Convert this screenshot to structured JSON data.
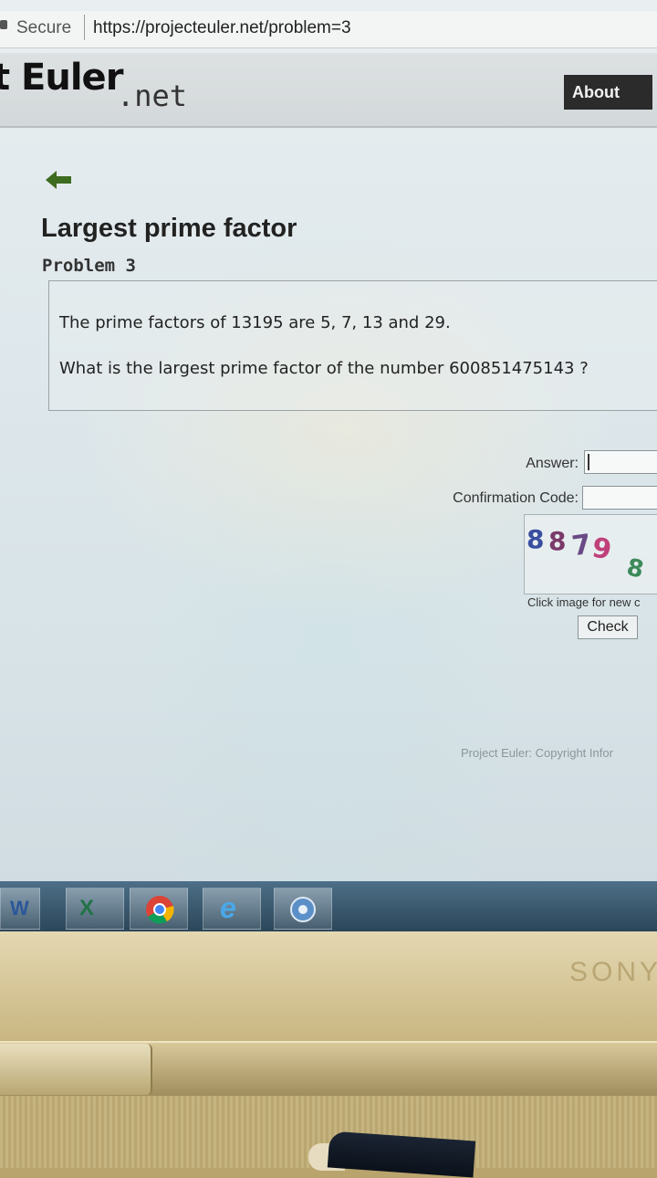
{
  "browser": {
    "secure_label": "Secure",
    "url": "https://projecteuler.net/problem=3"
  },
  "site": {
    "logo_main": "t Euler",
    "logo_suffix": ".net",
    "nav_about": "About"
  },
  "problem": {
    "title": "Largest prime factor",
    "number_label": "Problem 3",
    "line1": "The prime factors of 13195 are 5, 7, 13 and 29.",
    "line2": "What is the largest prime factor of the number 600851475143 ?"
  },
  "form": {
    "answer_label": "Answer:",
    "answer_value": "",
    "confirm_label": "Confirmation Code:",
    "confirm_value": "",
    "captcha": [
      "8",
      "8",
      "7",
      "9",
      "8"
    ],
    "captcha_hint": "Click image for new c",
    "check_label": "Check"
  },
  "footer": {
    "text": "Project Euler: Copyright Infor"
  },
  "taskbar": {
    "items": [
      "word-icon",
      "excel-icon",
      "chrome-icon",
      "ie-icon",
      "network-icon"
    ]
  },
  "laptop": {
    "brand": "SONY"
  }
}
